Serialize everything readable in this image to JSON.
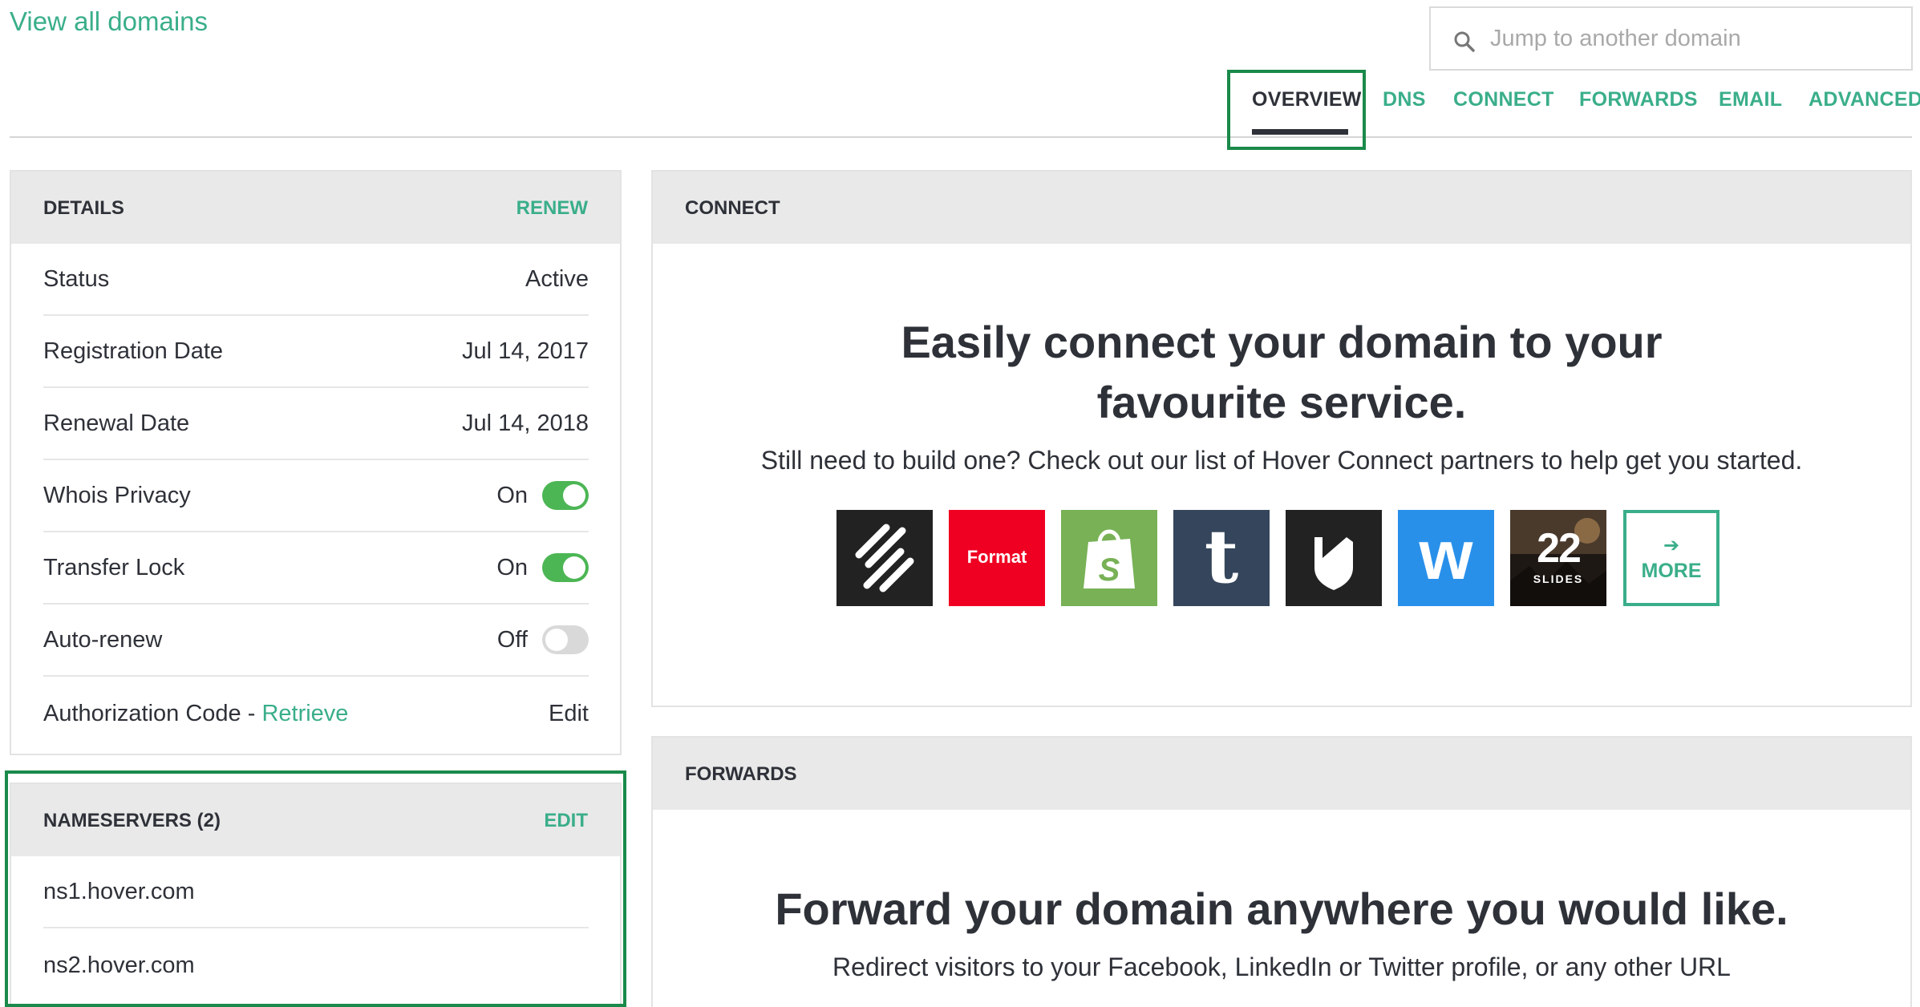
{
  "header": {
    "view_all": "View all domains",
    "search_placeholder": "Jump to another domain"
  },
  "tabs": [
    {
      "label": "OVERVIEW",
      "active": true
    },
    {
      "label": "DNS"
    },
    {
      "label": "CONNECT"
    },
    {
      "label": "FORWARDS"
    },
    {
      "label": "EMAIL"
    },
    {
      "label": "ADVANCED"
    }
  ],
  "details": {
    "title": "DETAILS",
    "action": "RENEW",
    "rows": [
      {
        "label": "Status",
        "value": "Active"
      },
      {
        "label": "Registration Date",
        "value": "Jul 14, 2017"
      },
      {
        "label": "Renewal Date",
        "value": "Jul 14, 2018"
      },
      {
        "label": "Whois Privacy",
        "value": "On",
        "toggle": true
      },
      {
        "label": "Transfer Lock",
        "value": "On",
        "toggle": true
      },
      {
        "label": "Auto-renew",
        "value": "Off",
        "toggle": false
      }
    ],
    "auth": {
      "label": "Authorization Code - ",
      "link": "Retrieve",
      "action": "Edit"
    }
  },
  "nameservers": {
    "title": "NAMESERVERS (2)",
    "action": "EDIT",
    "items": [
      "ns1.hover.com",
      "ns2.hover.com"
    ]
  },
  "connect": {
    "title": "CONNECT",
    "headline": "Easily connect your domain to your favourite service.",
    "subtext": "Still need to build one? Check out our list of Hover Connect partners to help get you started.",
    "partners": [
      {
        "icon": "squarespace-icon",
        "bg": "#222222"
      },
      {
        "icon": "format-icon",
        "label": "Format",
        "bg": "#ef0022"
      },
      {
        "icon": "shopify-icon",
        "bg": "#78b156"
      },
      {
        "icon": "tumblr-icon",
        "label": "t",
        "bg": "#35465c"
      },
      {
        "icon": "bigcartel-icon",
        "bg": "#222222"
      },
      {
        "icon": "weebly-icon",
        "label": "w",
        "bg": "#2990ea"
      },
      {
        "icon": "22slides-icon",
        "label": "22",
        "sublabel": "SLIDES",
        "bg": "#2a2320"
      }
    ],
    "more": {
      "arrow": "➔",
      "label": "MORE"
    }
  },
  "forwards": {
    "title": "FORWARDS",
    "headline": "Forward your domain anywhere you would like.",
    "subtext": "Redirect visitors to your Facebook, LinkedIn or Twitter profile, or any other URL"
  },
  "colors": {
    "accent": "#3aae8a",
    "toggle_on": "#4cb654",
    "highlight": "#1a8a4a",
    "panel_header": "#e9e9e9"
  }
}
